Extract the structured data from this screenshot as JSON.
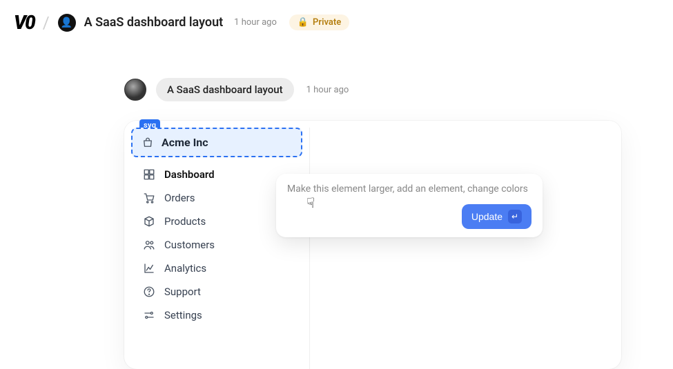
{
  "header": {
    "logo_text": "V0",
    "slash": "/",
    "title": "A SaaS dashboard layout",
    "timestamp": "1 hour ago",
    "badge": {
      "icon": "🔒",
      "label": "Private"
    }
  },
  "message": {
    "text": "A SaaS dashboard layout",
    "timestamp": "1 hour ago"
  },
  "selected_element_tag": "svg",
  "company_name": "Acme Inc",
  "nav": [
    {
      "label": "Dashboard",
      "icon": "dashboard",
      "active": true
    },
    {
      "label": "Orders",
      "icon": "cart"
    },
    {
      "label": "Products",
      "icon": "box"
    },
    {
      "label": "Customers",
      "icon": "users"
    },
    {
      "label": "Analytics",
      "icon": "chart"
    },
    {
      "label": "Support",
      "icon": "help"
    },
    {
      "label": "Settings",
      "icon": "sliders"
    }
  ],
  "popover": {
    "placeholder": "Make this element larger, add an element, change colors",
    "button_label": "Update",
    "kbd_hint": "↵"
  }
}
